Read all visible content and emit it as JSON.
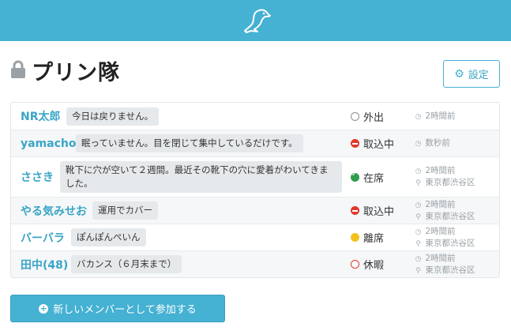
{
  "header": {
    "logo_icon": "seal-logo-icon",
    "brand_color": "#45b1d3"
  },
  "page": {
    "title": "プリン隊",
    "lock_icon": "lock-icon"
  },
  "settings": {
    "label": "設定",
    "icon": "gear-icon"
  },
  "members": [
    {
      "name": "NR太郎",
      "message": "今日は戻りません。",
      "status": "外出",
      "status_icon": "circle-outline-icon",
      "time": "2時間前",
      "location": ""
    },
    {
      "name": "yamacho",
      "message": "眠っていません。目を閉じて集中しているだけです。",
      "status": "取込中",
      "status_icon": "minus-circle-icon",
      "time": "数秒前",
      "location": ""
    },
    {
      "name": "ささき",
      "message": "靴下に穴が空いて２週間。最近その靴下の穴に愛着がわいてきました。",
      "status": "在席",
      "status_icon": "check-circle-icon",
      "time": "2時間前",
      "location": "東京都渋谷区"
    },
    {
      "name": "やる気みせお",
      "message": "運用でカバー",
      "status": "取込中",
      "status_icon": "minus-circle-icon",
      "time": "2時間前",
      "location": "東京都渋谷区"
    },
    {
      "name": "バーバラ",
      "message": "ぽんぽんぺいん",
      "status": "離席",
      "status_icon": "yellow-dot-icon",
      "time": "2時間前",
      "location": "東京都渋谷区"
    },
    {
      "name": "田中(48)",
      "message": "バカンス（６月末まで）",
      "status": "休暇",
      "status_icon": "red-circle-outline-icon",
      "time": "2時間前",
      "location": "東京都渋谷区"
    }
  ],
  "add_button": {
    "label": "新しいメンバーとして参加する",
    "icon": "plus-circle-icon"
  }
}
